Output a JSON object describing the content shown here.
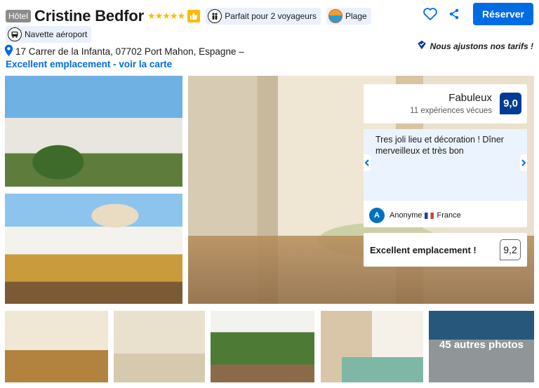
{
  "header": {
    "hotel_badge": "Hôtel",
    "hotel_name": "Cristine Bedfor",
    "stars": "★★★★★",
    "pills": [
      {
        "label": "Parfait pour 2 voyageurs",
        "icon": "people-icon"
      },
      {
        "label": "Plage",
        "icon": "beach-icon"
      }
    ],
    "shuttle": {
      "label": "Navette aéroport",
      "icon": "shuttle-icon"
    },
    "reserve_label": "Réserver"
  },
  "address": "17 Carrer de la Infanta, 07702 Port Mahon, Espagne –",
  "location_link": "Excellent emplacement - voir la carte",
  "price_note": "Nous ajustons nos tarifs !",
  "gallery": {
    "more_photos": "45 autres photos"
  },
  "review": {
    "score_word": "Fabuleux",
    "score_count": "11 expériences vécues",
    "score": "9,0",
    "quote": "Tres joli lieu et décoration ! Dîner merveilleux et très bon",
    "author_initial": "A",
    "author_name": "Anonyme",
    "author_country": "France",
    "location_label": "Excellent emplacement !",
    "location_score": "9,2"
  },
  "colors": {
    "primary": "#006ce4",
    "score_badge": "#003b95",
    "star": "#febb02",
    "pill_bg": "#eaf1fb"
  }
}
